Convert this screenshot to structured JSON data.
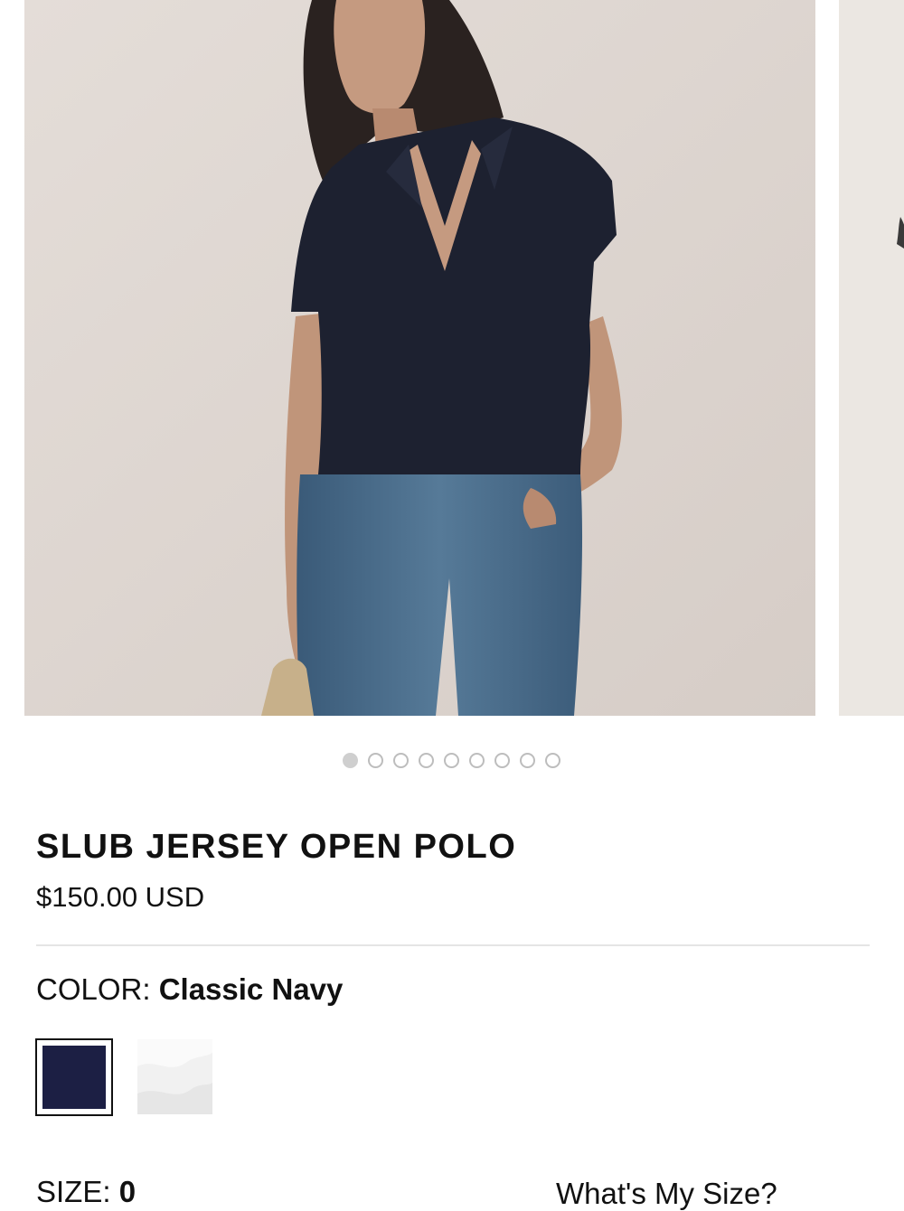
{
  "carousel": {
    "slide_count": 9,
    "active_index": 0,
    "main_image_alt": "Model wearing navy slub jersey open polo with blue jeans",
    "next_image_alt": "Next product image"
  },
  "product": {
    "title": "SLUB JERSEY OPEN POLO",
    "price": "$150.00 USD"
  },
  "color": {
    "label": "COLOR:",
    "selected": "Classic Navy",
    "swatches": [
      {
        "name": "Classic Navy",
        "hex": "#1c1f44",
        "selected": true
      },
      {
        "name": "White",
        "hex": "#f2f2f2",
        "selected": false
      }
    ]
  },
  "size": {
    "label": "SIZE:",
    "selected": "0",
    "guide_link": "What's My Size?"
  }
}
